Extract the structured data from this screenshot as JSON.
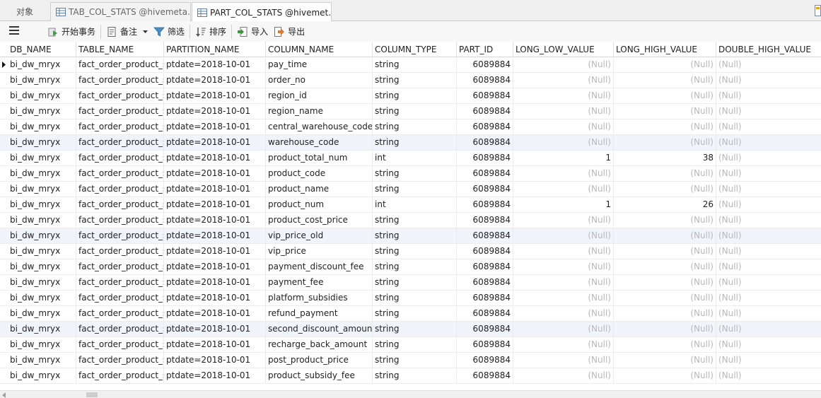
{
  "tabs": {
    "objects_label": "对象",
    "tab1_label": "TAB_COL_STATS @hivemeta...",
    "tab2_label": "PART_COL_STATS @hivemet..."
  },
  "toolbar": {
    "begin_transaction": "开始事务",
    "note": "备注",
    "filter": "筛选",
    "sort": "排序",
    "import": "导入",
    "export": "导出"
  },
  "grid": {
    "columns": [
      "DB_NAME",
      "TABLE_NAME",
      "PARTITION_NAME",
      "COLUMN_NAME",
      "COLUMN_TYPE",
      "PART_ID",
      "LONG_LOW_VALUE",
      "LONG_HIGH_VALUE",
      "DOUBLE_HIGH_VALUE"
    ],
    "rows": [
      [
        "bi_dw_mryx",
        "fact_order_product_s",
        "ptdate=2018-10-01",
        "pay_time",
        "string",
        "6089884",
        "(Null)",
        "(Null)",
        "(Null)"
      ],
      [
        "bi_dw_mryx",
        "fact_order_product_s",
        "ptdate=2018-10-01",
        "order_no",
        "string",
        "6089884",
        "(Null)",
        "(Null)",
        "(Null)"
      ],
      [
        "bi_dw_mryx",
        "fact_order_product_s",
        "ptdate=2018-10-01",
        "region_id",
        "string",
        "6089884",
        "(Null)",
        "(Null)",
        "(Null)"
      ],
      [
        "bi_dw_mryx",
        "fact_order_product_s",
        "ptdate=2018-10-01",
        "region_name",
        "string",
        "6089884",
        "(Null)",
        "(Null)",
        "(Null)"
      ],
      [
        "bi_dw_mryx",
        "fact_order_product_s",
        "ptdate=2018-10-01",
        "central_warehouse_code",
        "string",
        "6089884",
        "(Null)",
        "(Null)",
        "(Null)"
      ],
      [
        "bi_dw_mryx",
        "fact_order_product_s",
        "ptdate=2018-10-01",
        "warehouse_code",
        "string",
        "6089884",
        "(Null)",
        "(Null)",
        "(Null)"
      ],
      [
        "bi_dw_mryx",
        "fact_order_product_s",
        "ptdate=2018-10-01",
        "product_total_num",
        "int",
        "6089884",
        "1",
        "38",
        "(Null)"
      ],
      [
        "bi_dw_mryx",
        "fact_order_product_s",
        "ptdate=2018-10-01",
        "product_code",
        "string",
        "6089884",
        "(Null)",
        "(Null)",
        "(Null)"
      ],
      [
        "bi_dw_mryx",
        "fact_order_product_s",
        "ptdate=2018-10-01",
        "product_name",
        "string",
        "6089884",
        "(Null)",
        "(Null)",
        "(Null)"
      ],
      [
        "bi_dw_mryx",
        "fact_order_product_s",
        "ptdate=2018-10-01",
        "product_num",
        "int",
        "6089884",
        "1",
        "26",
        "(Null)"
      ],
      [
        "bi_dw_mryx",
        "fact_order_product_s",
        "ptdate=2018-10-01",
        "product_cost_price",
        "string",
        "6089884",
        "(Null)",
        "(Null)",
        "(Null)"
      ],
      [
        "bi_dw_mryx",
        "fact_order_product_s",
        "ptdate=2018-10-01",
        "vip_price_old",
        "string",
        "6089884",
        "(Null)",
        "(Null)",
        "(Null)"
      ],
      [
        "bi_dw_mryx",
        "fact_order_product_s",
        "ptdate=2018-10-01",
        "vip_price",
        "string",
        "6089884",
        "(Null)",
        "(Null)",
        "(Null)"
      ],
      [
        "bi_dw_mryx",
        "fact_order_product_s",
        "ptdate=2018-10-01",
        "payment_discount_fee",
        "string",
        "6089884",
        "(Null)",
        "(Null)",
        "(Null)"
      ],
      [
        "bi_dw_mryx",
        "fact_order_product_s",
        "ptdate=2018-10-01",
        "payment_fee",
        "string",
        "6089884",
        "(Null)",
        "(Null)",
        "(Null)"
      ],
      [
        "bi_dw_mryx",
        "fact_order_product_s",
        "ptdate=2018-10-01",
        "platform_subsidies",
        "string",
        "6089884",
        "(Null)",
        "(Null)",
        "(Null)"
      ],
      [
        "bi_dw_mryx",
        "fact_order_product_s",
        "ptdate=2018-10-01",
        "refund_payment",
        "string",
        "6089884",
        "(Null)",
        "(Null)",
        "(Null)"
      ],
      [
        "bi_dw_mryx",
        "fact_order_product_s",
        "ptdate=2018-10-01",
        "second_discount_amount",
        "string",
        "6089884",
        "(Null)",
        "(Null)",
        "(Null)"
      ],
      [
        "bi_dw_mryx",
        "fact_order_product_s",
        "ptdate=2018-10-01",
        "recharge_back_amount",
        "string",
        "6089884",
        "(Null)",
        "(Null)",
        "(Null)"
      ],
      [
        "bi_dw_mryx",
        "fact_order_product_s",
        "ptdate=2018-10-01",
        "post_product_price",
        "string",
        "6089884",
        "(Null)",
        "(Null)",
        "(Null)"
      ],
      [
        "bi_dw_mryx",
        "fact_order_product_s",
        "ptdate=2018-10-01",
        "product_subsidy_fee",
        "string",
        "6089884",
        "(Null)",
        "(Null)",
        "(Null)"
      ]
    ],
    "selected_row": 0
  }
}
